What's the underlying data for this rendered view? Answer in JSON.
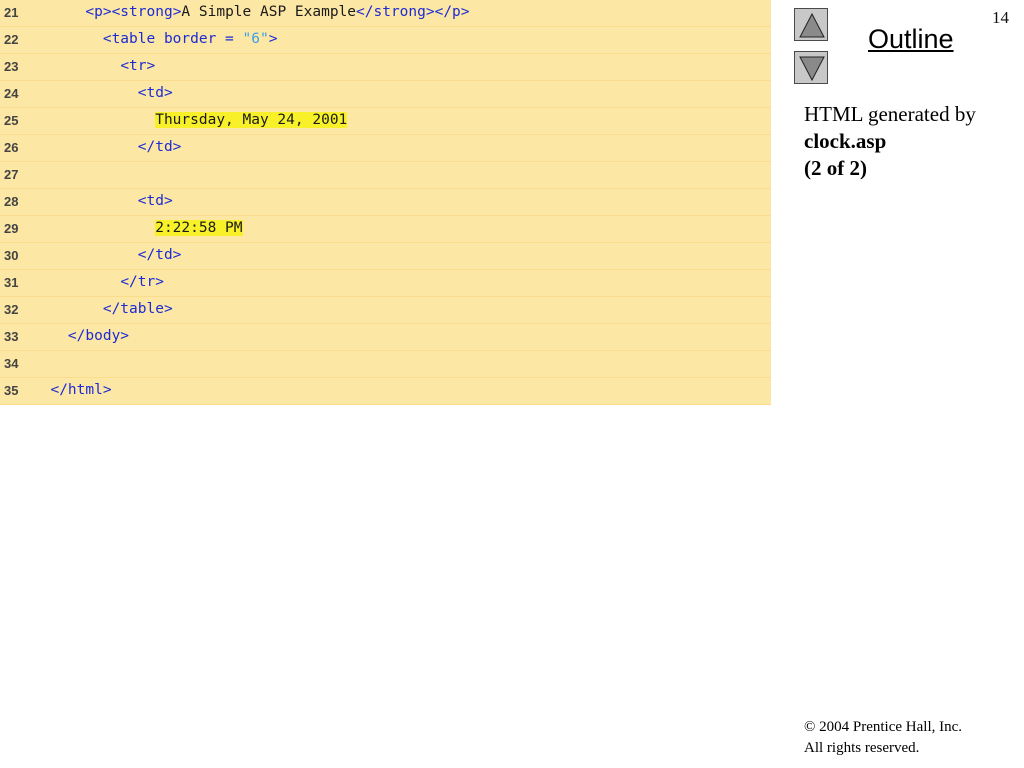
{
  "slide_number": "14",
  "outline": {
    "label": "Outline",
    "prev_icon": "triangle-up-icon",
    "next_icon": "triangle-down-icon"
  },
  "caption": {
    "line1": "HTML generated by",
    "line2": "clock.asp",
    "line3": "(2 of 2)"
  },
  "copyright": {
    "line1": "© 2004 Prentice Hall, Inc.",
    "line2": "All rights reserved."
  },
  "code_lines": [
    {
      "num": "21",
      "indent": "      ",
      "parts": [
        {
          "t": "<p><strong>",
          "c": "tag"
        },
        {
          "t": "A Simple ASP Example",
          "c": "black"
        },
        {
          "t": "</strong></p>",
          "c": "tag"
        }
      ]
    },
    {
      "num": "22",
      "indent": "        ",
      "parts": [
        {
          "t": "<table border = ",
          "c": "tag"
        },
        {
          "t": "\"6\"",
          "c": "str"
        },
        {
          "t": ">",
          "c": "tag"
        }
      ]
    },
    {
      "num": "23",
      "indent": "          ",
      "parts": [
        {
          "t": "<tr>",
          "c": "tag"
        }
      ]
    },
    {
      "num": "24",
      "indent": "            ",
      "parts": [
        {
          "t": "<td>",
          "c": "tag"
        }
      ]
    },
    {
      "num": "25",
      "indent": "              ",
      "parts": [
        {
          "t": "Thursday, May 24, 2001",
          "c": "hl"
        }
      ]
    },
    {
      "num": "26",
      "indent": "            ",
      "parts": [
        {
          "t": "</td>",
          "c": "tag"
        }
      ]
    },
    {
      "num": "27",
      "indent": "",
      "parts": []
    },
    {
      "num": "28",
      "indent": "            ",
      "parts": [
        {
          "t": "<td>",
          "c": "tag"
        }
      ]
    },
    {
      "num": "29",
      "indent": "              ",
      "parts": [
        {
          "t": "2:22:58 PM",
          "c": "hl"
        }
      ]
    },
    {
      "num": "30",
      "indent": "            ",
      "parts": [
        {
          "t": "</td>",
          "c": "tag"
        }
      ]
    },
    {
      "num": "31",
      "indent": "          ",
      "parts": [
        {
          "t": "</tr>",
          "c": "tag"
        }
      ]
    },
    {
      "num": "32",
      "indent": "        ",
      "parts": [
        {
          "t": "</table>",
          "c": "tag"
        }
      ]
    },
    {
      "num": "33",
      "indent": "    ",
      "parts": [
        {
          "t": "</body>",
          "c": "tag"
        }
      ]
    },
    {
      "num": "34",
      "indent": "",
      "parts": []
    },
    {
      "num": "35",
      "indent": "  ",
      "parts": [
        {
          "t": "</html>",
          "c": "tag"
        }
      ]
    }
  ]
}
